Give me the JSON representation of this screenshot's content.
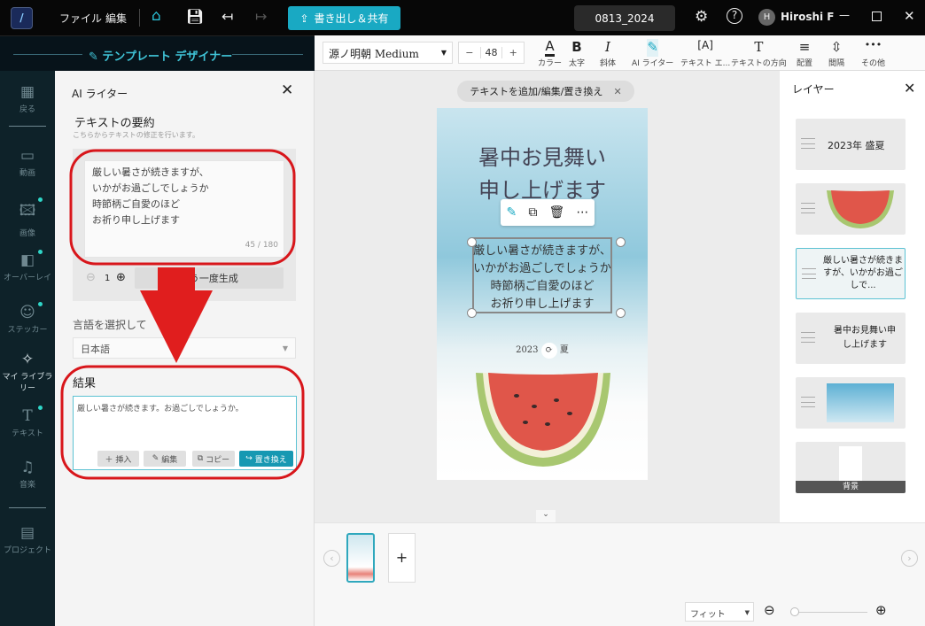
{
  "topbar": {
    "menu_file": "ファイル",
    "menu_edit": "編集",
    "export_label": "書き出し＆共有",
    "project_name": "0813_2024",
    "user_initial": "H",
    "user_name": "Hiroshi F"
  },
  "designer_title": "テンプレート デザイナー",
  "toolbar": {
    "font": "源ノ明朝 Medium",
    "font_size": "48",
    "minus": "−",
    "plus": "+",
    "tools": [
      {
        "label": "カラー",
        "icon": "A"
      },
      {
        "label": "太字",
        "icon": "B"
      },
      {
        "label": "斜体",
        "icon": "I"
      },
      {
        "label": "AI ライター",
        "icon": "✎"
      },
      {
        "label": "テキスト エ...",
        "icon": "[A]"
      },
      {
        "label": "テキストの方向",
        "icon": "T"
      },
      {
        "label": "配置",
        "icon": "≡"
      },
      {
        "label": "間隔",
        "icon": "⇳"
      },
      {
        "label": "その他",
        "icon": "•••"
      }
    ]
  },
  "rail": [
    {
      "label": "戻る",
      "icon": "▦"
    },
    {
      "label": "動画",
      "icon": "▭"
    },
    {
      "label": "画像",
      "icon": "🖾"
    },
    {
      "label": "オーバーレイ",
      "icon": "◧"
    },
    {
      "label": "ステッカー",
      "icon": "☺"
    },
    {
      "label": "マイ ライブラリー",
      "icon": "✧"
    },
    {
      "label": "テキスト",
      "icon": "T"
    },
    {
      "label": "音楽",
      "icon": "♫"
    },
    {
      "label": "プロジェクト",
      "icon": "▤"
    }
  ],
  "ai_panel": {
    "title": "AI ライター",
    "section": "テキストの要約",
    "hint": "こちらからテキストの修正を行います。",
    "input_lines": [
      "厳しい暑さが続きますが、",
      "いかがお過ごしでしょうか",
      "時節柄ご自愛のほど",
      "お祈り申し上げます"
    ],
    "char_count": "45 / 180",
    "count_value": "1",
    "regenerate": "もう一度生成",
    "language_label": "言語を選択して",
    "language": "日本語",
    "result_label": "結果",
    "result_text": "厳しい暑さが続きます。お過ごしでしょうか。",
    "insert": "挿入",
    "edit": "編集",
    "copy": "コピー",
    "replace": "置き換え"
  },
  "canvas": {
    "hint_pill": "テキストを追加/編集/置き換え",
    "title_lines": [
      "暑中お見舞い",
      "申し上げます"
    ],
    "body_lines": [
      "厳しい暑さが続きますが、",
      "いかがお過ごしでしょうか",
      "時節柄ご自愛のほど",
      "お祈り申し上げます"
    ],
    "year_left": "2023",
    "year_right": "夏"
  },
  "layers": {
    "title": "レイヤー",
    "items": [
      {
        "text": "2023年 盛夏"
      },
      {
        "text": ""
      },
      {
        "text": "厳しい暑さが続きますが、いかがお過ごしで..."
      },
      {
        "text": "暑中お見舞い申し上げます"
      },
      {
        "text": ""
      },
      {
        "text": "背景"
      }
    ]
  },
  "bottom": {
    "zoom_mode": "フィット",
    "add_page": "+"
  },
  "colors": {
    "accent": "#19a9c3",
    "annotation": "#e01e1e"
  }
}
